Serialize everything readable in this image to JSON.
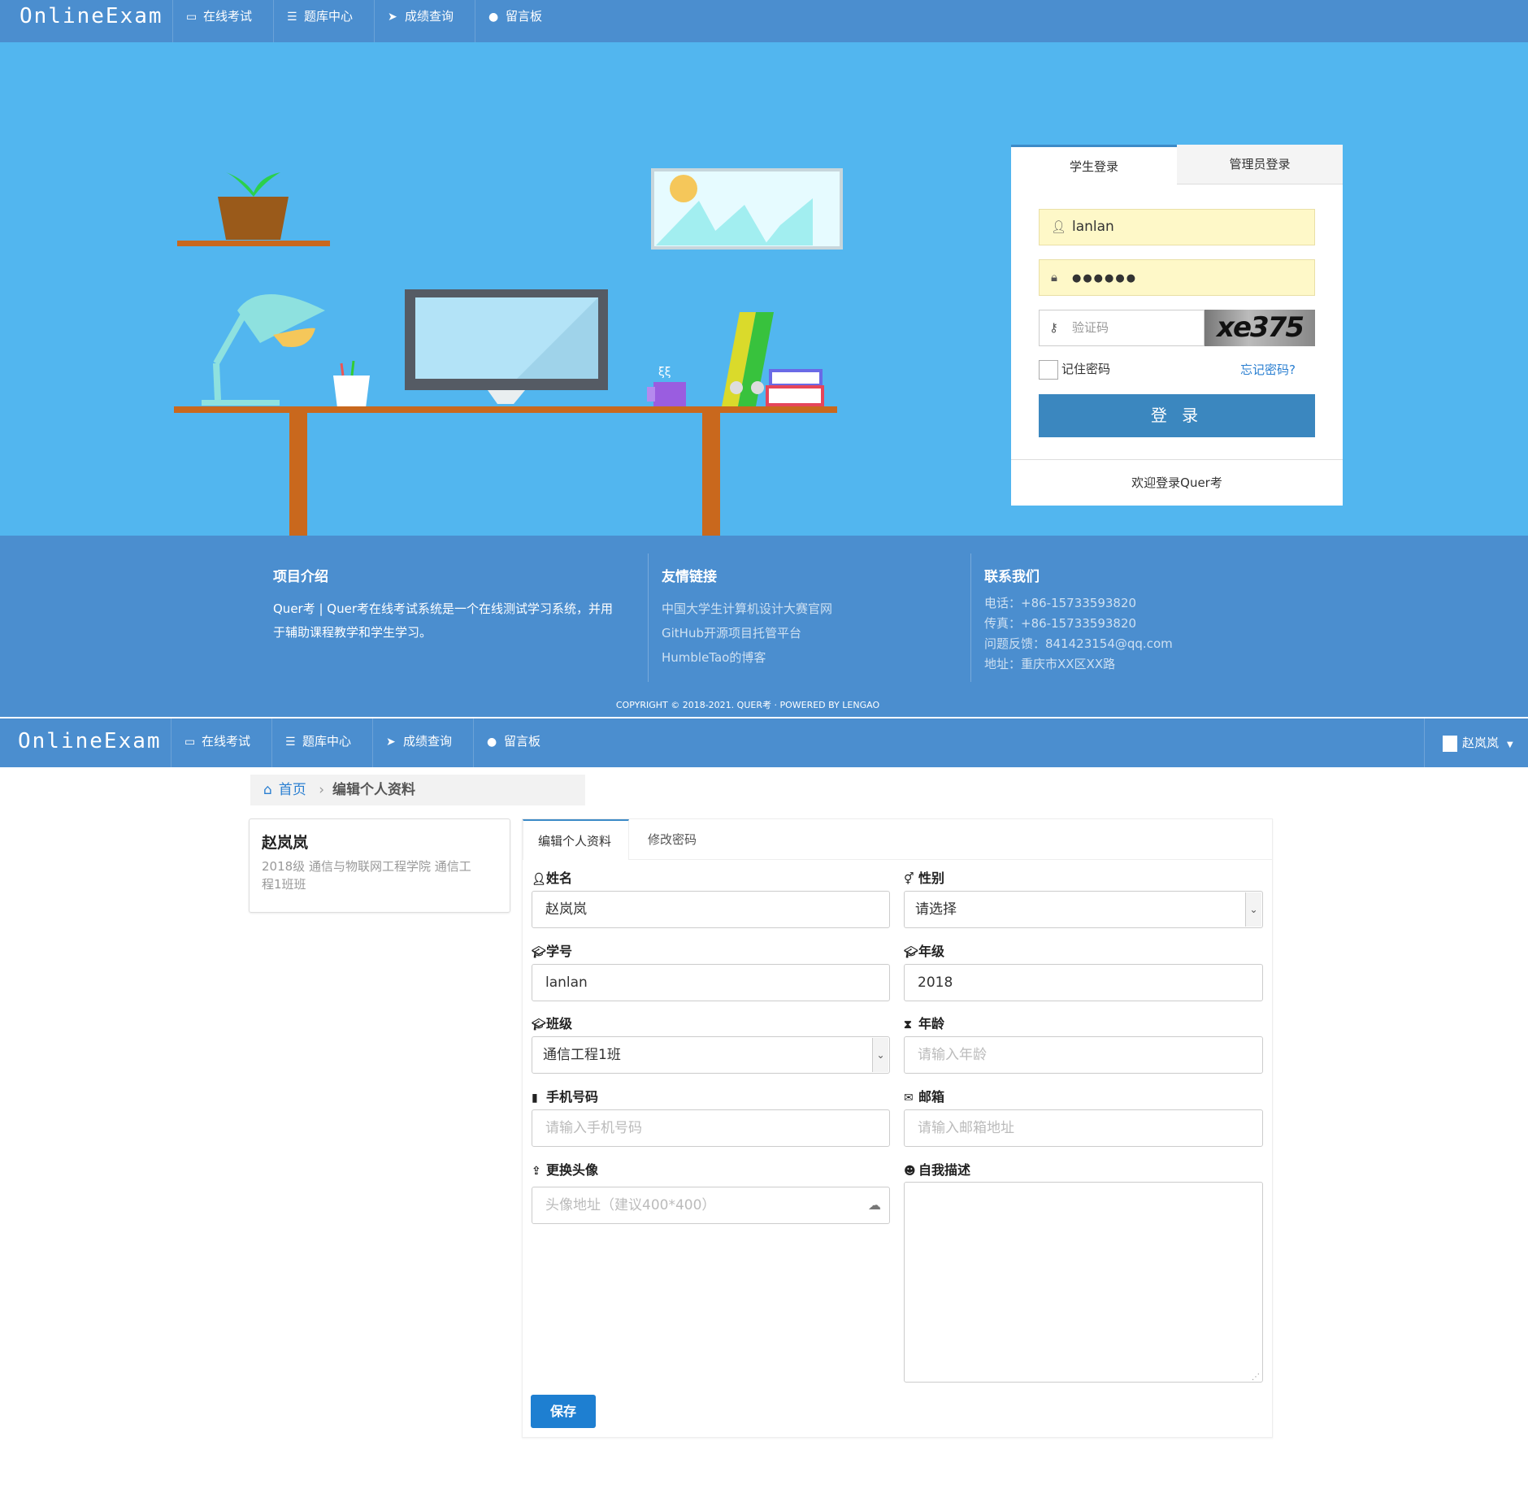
{
  "nav": {
    "brand": "OnlineExam",
    "items": [
      {
        "label": "在线考试",
        "icon": "monitor-icon"
      },
      {
        "label": "题库中心",
        "icon": "list-icon"
      },
      {
        "label": "成绩查询",
        "icon": "paper-plane-icon"
      },
      {
        "label": "留言板",
        "icon": "comment-icon"
      }
    ]
  },
  "login": {
    "tabs": [
      "学生登录",
      "管理员登录"
    ],
    "username": "lanlan",
    "password": "●●●●●●",
    "captcha_placeholder": "验证码",
    "captcha_text": "xe375",
    "remember_label": "记住密码",
    "forgot_label": "忘记密码?",
    "submit_label": "登 录",
    "footer_text": "欢迎登录Quer考"
  },
  "footer": {
    "about": {
      "title": "项目介绍",
      "lines": [
        "Quer考 | Quer考在线考试系统是一个在线测试学习系统，并用",
        "于辅助课程教学和学生学习。"
      ]
    },
    "links": {
      "title": "友情链接",
      "items": [
        "中国大学生计算机设计大赛官网",
        "GitHub开源项目托管平台",
        "HumbleTao的博客"
      ]
    },
    "contact": {
      "title": "联系我们",
      "items": [
        "电话：+86-15733593820",
        "传真：+86-15733593820",
        "问题反馈：841423154@qq.com",
        "地址：重庆市XX区XX路"
      ]
    },
    "copyright": "COPYRIGHT © 2018-2021. QUER考 · POWERED BY LENGAO"
  },
  "user": {
    "name": "赵岚岚"
  },
  "breadcrumb": {
    "home": "首页",
    "current": "编辑个人资料"
  },
  "profile": {
    "name": "赵岚岚",
    "desc_line1": "2018级  通信与物联网工程学院  通信工",
    "desc_line2": "程1班班"
  },
  "form": {
    "tabs": [
      "编辑个人资料",
      "修改密码"
    ],
    "name_label": "姓名",
    "name_value": "赵岚岚",
    "gender_label": "性别",
    "gender_value": "请选择",
    "student_id_label": "学号",
    "student_id_value": "lanlan",
    "grade_label": "年级",
    "grade_value": "2018",
    "class_label": "班级",
    "class_value": "通信工程1班",
    "age_label": "年龄",
    "age_placeholder": "请输入年龄",
    "phone_label": "手机号码",
    "phone_placeholder": "请输入手机号码",
    "email_label": "邮箱",
    "email_placeholder": "请输入邮箱地址",
    "avatar_label": "更换头像",
    "avatar_placeholder": "头像地址（建议400*400）",
    "bio_label": "自我描述",
    "save_label": "保存"
  }
}
